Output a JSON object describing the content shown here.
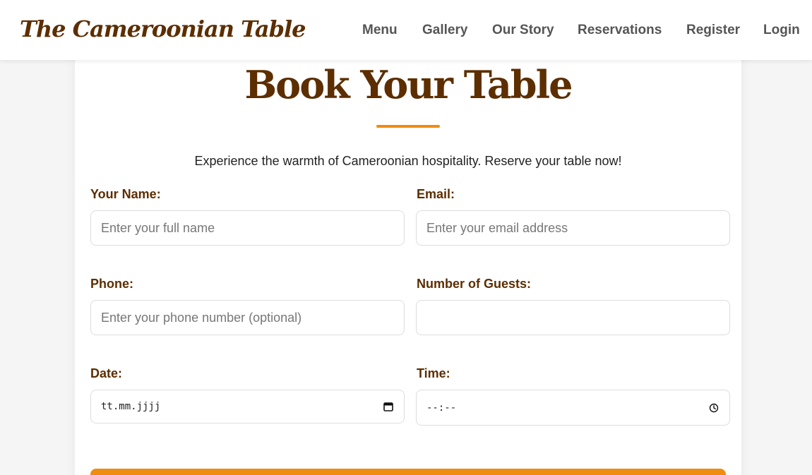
{
  "nav": {
    "brand": "The Cameroonian Table",
    "links": [
      "Menu",
      "Gallery",
      "Our Story",
      "Reservations",
      "Register",
      "Login"
    ]
  },
  "form": {
    "title": "Book Your Table",
    "subtitle": "Experience the warmth of Cameroonian hospitality. Reserve your table now!",
    "name": {
      "label": "Your Name:",
      "placeholder": "Enter your full name",
      "value": ""
    },
    "email": {
      "label": "Email:",
      "placeholder": "Enter your email address",
      "value": ""
    },
    "phone": {
      "label": "Phone:",
      "placeholder": "Enter your phone number (optional)",
      "value": ""
    },
    "guests": {
      "label": "Number of Guests:",
      "value": ""
    },
    "date": {
      "label": "Date:",
      "value": "tt.mm.jjjj"
    },
    "time": {
      "label": "Time:",
      "value": "--:--"
    }
  },
  "colors": {
    "brand_brown": "#5c2e00",
    "accent_orange": "#f08c10",
    "nav_text": "#555555"
  },
  "icons": {
    "date_picker": "calendar-icon",
    "time_picker": "clock-icon"
  }
}
